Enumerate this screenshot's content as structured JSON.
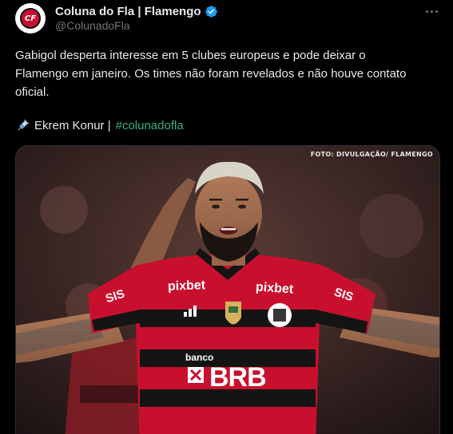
{
  "author": {
    "display_name": "Coluna do Fla | Flamengo",
    "handle": "@ColunadoFla",
    "avatar_text": "CF"
  },
  "tweet": {
    "text_line1": "Gabigol desperta interesse em 5 clubes europeus e pode deixar o",
    "text_line2": "Flamengo em janeiro. Os times não foram revelados e não houve contato",
    "text_line3": "oficial.",
    "credit_name": "Ekrem Konur |",
    "hashtag": "#colunadofla"
  },
  "photo": {
    "caption": "FOTO: DIVULGAÇÃO/ FLAMENGO",
    "shirt_sponsor_1": "pixbet",
    "shirt_sponsor_2": "pixbet",
    "shirt_sponsor_3": "banco",
    "shirt_sponsor_4": "BRB",
    "sleeve_left": "SIS",
    "sleeve_right": "SIS"
  },
  "colors": {
    "verified": "#1d9bf0",
    "hashtag": "#39b08a",
    "flamengo_red": "#c8102e"
  }
}
